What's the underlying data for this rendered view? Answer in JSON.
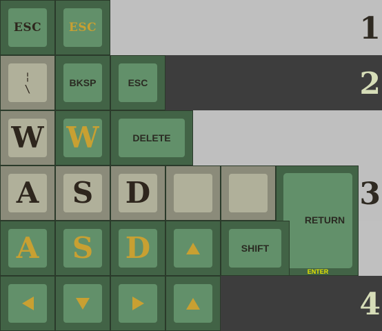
{
  "rows": [
    {
      "number": "1"
    },
    {
      "number": "2"
    },
    {
      "number": "3"
    },
    {
      "number": "4"
    }
  ],
  "keys": {
    "esc_dark": "ESC",
    "esc_gold": "ESC",
    "pipe_top": "¦",
    "pipe_bottom": "\\",
    "bksp": "BKSP",
    "esc_plain": "ESC",
    "w_dark": "W",
    "w_gold": "W",
    "delete": "DELETE",
    "a_dark": "A",
    "s_dark": "S",
    "d_dark": "D",
    "a_gold": "A",
    "s_gold": "S",
    "d_gold": "D",
    "shift": "SHIFT",
    "return": "RETURN",
    "enter": "ENTER"
  },
  "colors": {
    "green_key": "#426346",
    "green_cap": "#62906a",
    "beige_key": "#8b8b7a",
    "beige_cap": "#b0b09a",
    "gold_legend": "#c8a032",
    "dark_legend": "#2e261d",
    "enter_label": "#e6e600"
  },
  "icons": [
    "arrow-up-icon",
    "arrow-down-icon",
    "arrow-left-icon",
    "arrow-right-icon"
  ]
}
